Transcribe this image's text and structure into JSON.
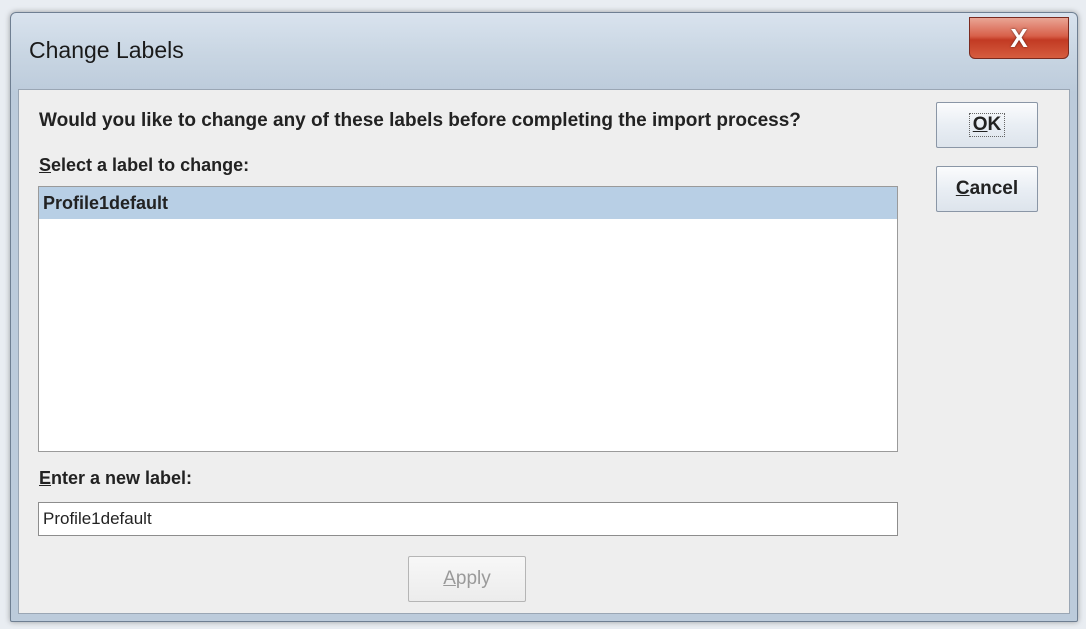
{
  "window": {
    "title": "Change Labels",
    "close_symbol": "X"
  },
  "dialog": {
    "prompt": "Would you like to change any of these labels before completing the import process?",
    "select_label_mnemonic": "S",
    "select_label_rest": "elect a label to change:",
    "labels": [
      {
        "text": "Profile1default",
        "selected": true
      }
    ],
    "enter_label_mnemonic": "E",
    "enter_label_rest": "nter a new label:",
    "new_label_value": "Profile1default"
  },
  "buttons": {
    "ok_mnemonic": "O",
    "ok_rest": "K",
    "cancel_mnemonic": "C",
    "cancel_rest": "ancel",
    "apply_mnemonic": "A",
    "apply_rest": "pply",
    "apply_enabled": false
  },
  "colors": {
    "selection": "#b8cfe5",
    "close_button": "#c23a23"
  }
}
